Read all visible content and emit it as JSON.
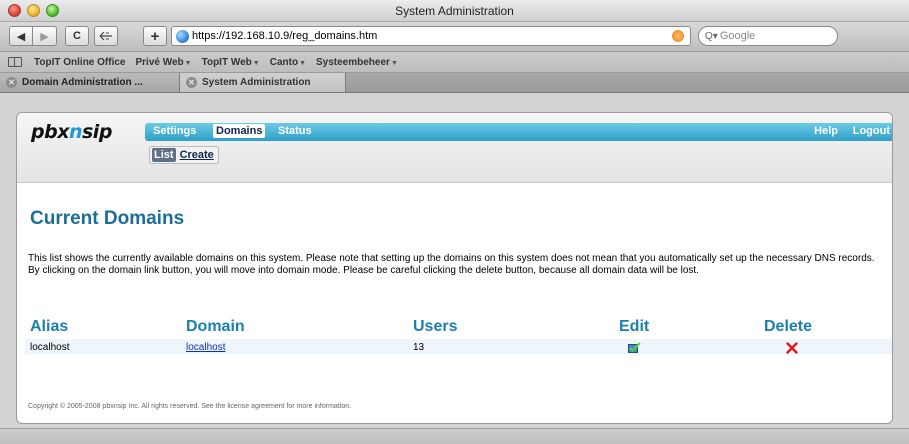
{
  "window": {
    "title": "System Administration"
  },
  "toolbar": {
    "back_label": "◀",
    "forward_label": "▶",
    "reload_label": "C",
    "add_label": "+",
    "url": "https://192.168.10.9/reg_domains.htm",
    "search_placeholder": "Google"
  },
  "bookmarks": {
    "items": [
      {
        "label": "TopIT Online Office",
        "has_menu": false
      },
      {
        "label": "Privé Web",
        "has_menu": true
      },
      {
        "label": "TopIT Web",
        "has_menu": true
      },
      {
        "label": "Canto",
        "has_menu": true
      },
      {
        "label": "Systeembeheer",
        "has_menu": true
      }
    ]
  },
  "tabs": [
    {
      "label": "Domain Administration ...",
      "active": false
    },
    {
      "label": "System Administration",
      "active": true
    }
  ],
  "app": {
    "logo_prefix": "pbx",
    "logo_x": "n",
    "logo_suffix": "sip",
    "nav": {
      "settings": "Settings",
      "domains": "Domains",
      "status": "Status",
      "help": "Help",
      "logout": "Logout"
    },
    "subnav": {
      "list": "List",
      "create": "Create"
    },
    "title": "Current Domains",
    "description": {
      "line1": "This list shows the currently available domains on this system. Please note that setting up the domains on this system does not mean that you automatically set up the necessary DNS records.",
      "line2": "By clicking on the domain link button, you will move into domain mode. Please be careful clicking the delete button, because all domain data will be lost."
    },
    "table": {
      "headers": {
        "alias": "Alias",
        "domain": "Domain",
        "users": "Users",
        "edit": "Edit",
        "delete": "Delete"
      },
      "rows": [
        {
          "alias": "localhost",
          "domain": "localhost",
          "users": "13"
        }
      ]
    },
    "footer": "Copyright © 2005-2008 pbxnsip Inc. All rights reserved. See the license agreement for more information."
  },
  "colors": {
    "accent": "#2e9fc8",
    "heading": "#1c6e95",
    "table_header": "#1c80ad",
    "link": "#0a2fb8"
  },
  "icons": {
    "edit": "edit-check-icon",
    "delete": "delete-x-icon",
    "secure": "globe-icon",
    "rss": "rss-icon"
  }
}
